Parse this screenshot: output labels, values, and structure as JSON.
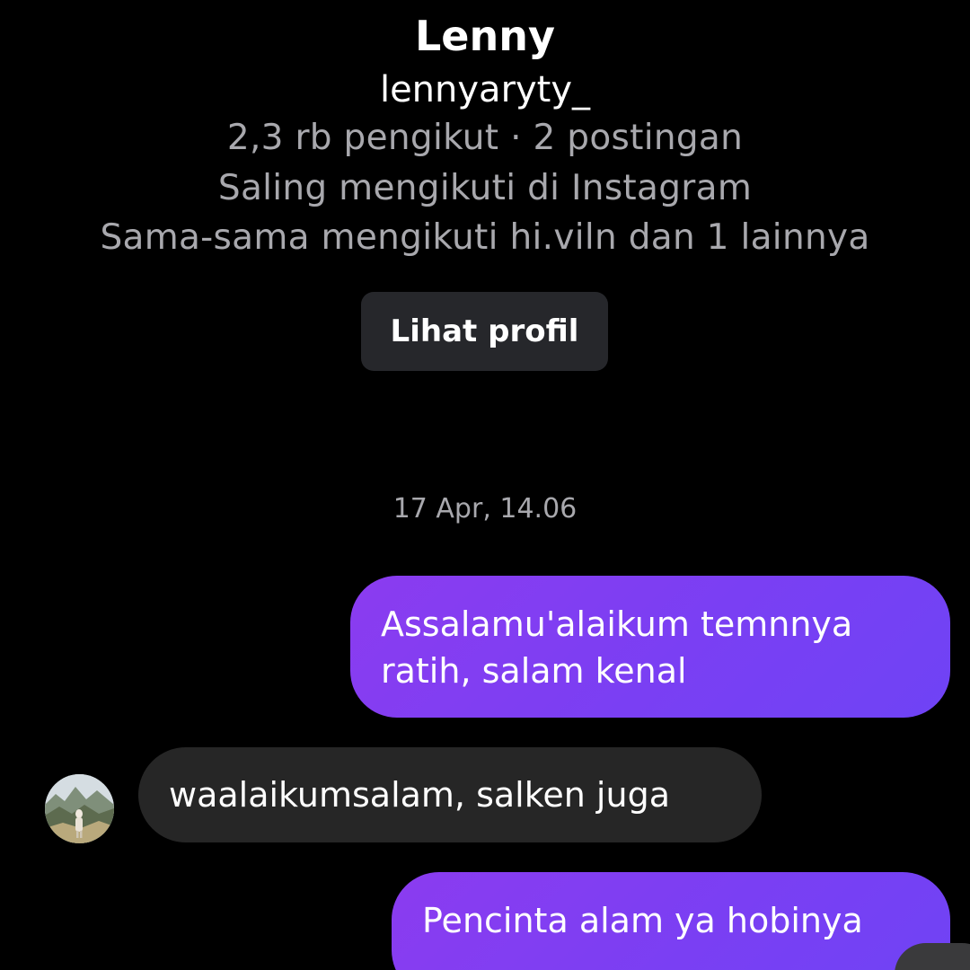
{
  "profile": {
    "name": "Lenny",
    "username": "lennyaryty_",
    "stats": "2,3 rb pengikut · 2 postingan",
    "follow_status": "Saling mengikuti di Instagram",
    "mutual": "Sama-sama mengikuti hi.viln dan 1 lainnya",
    "view_profile_label": "Lihat profil"
  },
  "conversation": {
    "timestamp": "17 Apr, 14.06",
    "messages": [
      {
        "direction": "sent",
        "text": "Assalamu'alaikum temnnya ratih, salam kenal"
      },
      {
        "direction": "received",
        "text": "waalaikumsalam, salken juga"
      },
      {
        "direction": "sent",
        "text": "Pencinta alam ya hobinya"
      }
    ]
  },
  "colors": {
    "background": "#000000",
    "sent_bubble": "#7a3ff3",
    "received_bubble": "#262626",
    "button_bg": "#26272b",
    "muted_text": "#a8a8ad"
  },
  "icons": {
    "avatar": "avatar-photo"
  }
}
